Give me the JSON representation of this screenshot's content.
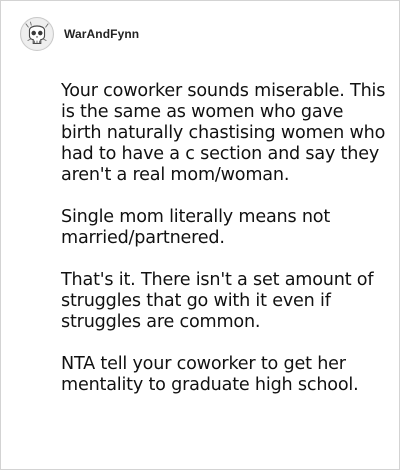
{
  "comment": {
    "author": "WarAndFynn",
    "avatar_icon": "skull-sketch-icon",
    "paragraphs": [
      "Your coworker sounds miserable. This is the same as women who gave birth naturally chastising women who had to have a c section and say they aren't a real mom/woman.",
      "Single mom literally means not married/partnered.",
      "That's it. There isn't a set amount of struggles that go with it even if struggles are common.",
      "NTA tell your coworker to get her mentality to graduate high school."
    ]
  }
}
